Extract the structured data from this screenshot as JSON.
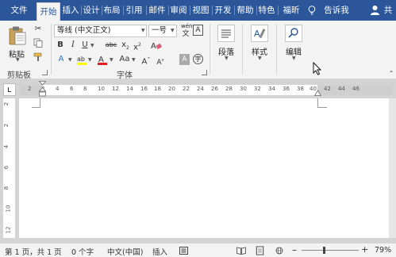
{
  "tabs": [
    {
      "label": "文件"
    },
    {
      "label": "开始"
    },
    {
      "label": "插入"
    },
    {
      "label": "设计"
    },
    {
      "label": "布局"
    },
    {
      "label": "引用"
    },
    {
      "label": "邮件"
    },
    {
      "label": "审阅"
    },
    {
      "label": "视图"
    },
    {
      "label": "开发"
    },
    {
      "label": "帮助"
    },
    {
      "label": "特色"
    },
    {
      "label": "福昕"
    }
  ],
  "tell_me": "告诉我",
  "share": "共",
  "ribbon": {
    "clipboard": {
      "paste": "粘贴",
      "group": "剪贴板"
    },
    "font": {
      "font_name": "等线 (中文正文)",
      "font_size": "一号",
      "wen": "wén",
      "group": "字体"
    },
    "paragraph": {
      "label": "段落"
    },
    "styles": {
      "label": "样式"
    },
    "editing": {
      "label": "编辑"
    }
  },
  "ruler": {
    "h_ticks": [
      "2",
      "2",
      "4",
      "6",
      "8",
      "10",
      "12",
      "14",
      "16",
      "18",
      "20",
      "22",
      "24",
      "26",
      "28",
      "30",
      "32",
      "34",
      "36",
      "38",
      "40",
      "42",
      "44",
      "46"
    ],
    "v_ticks": [
      "2",
      "2",
      "4",
      "6",
      "8",
      "10",
      "12"
    ]
  },
  "status": {
    "page": "第 1 页，共 1 页",
    "words": "0 个字",
    "lang": "中文(中国)",
    "insert": "插入",
    "zoom": "79%"
  },
  "colors": {
    "accent": "#2b579a",
    "ribbon": "#f3f3f3",
    "canvas": "#d4d4d4"
  }
}
